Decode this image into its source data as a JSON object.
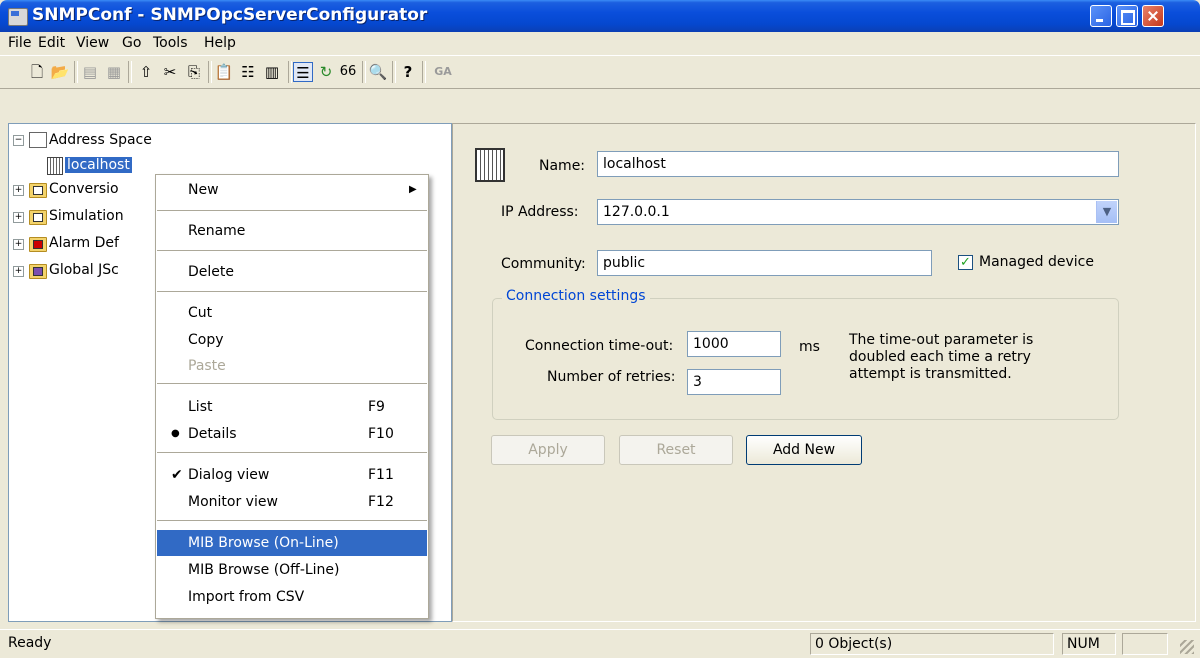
{
  "window": {
    "title": "SNMPConf - SNMPOpcServerConfigurator"
  },
  "menubar": [
    "File",
    "Edit",
    "View",
    "Go",
    "Tools",
    "Help"
  ],
  "toolbar": {
    "icons": [
      "new-icon",
      "open-icon",
      "copy-format-icon",
      "properties-icon",
      "folder-up-icon",
      "cut-icon",
      "copy-icon",
      "paste-icon",
      "list-icon",
      "details-icon",
      "dialog-view-icon",
      "refresh-icon",
      "watch-icon",
      "search-icon",
      "help-icon",
      "ga-icon"
    ],
    "ga_label": "GA"
  },
  "tree": {
    "root": "Address Space",
    "selected": "localhost",
    "items": [
      "Conversio",
      "Simulation",
      "Alarm Def",
      "Global JSc"
    ]
  },
  "context_menu": {
    "items": [
      {
        "label": "New",
        "has_submenu": true
      },
      {
        "label": "Rename"
      },
      {
        "label": "Delete"
      },
      {
        "label": "Cut"
      },
      {
        "label": "Copy"
      },
      {
        "label": "Paste",
        "disabled": true
      },
      {
        "label": "List",
        "shortcut": "F9"
      },
      {
        "label": "Details",
        "shortcut": "F10",
        "radio": true
      },
      {
        "label": "Dialog view",
        "shortcut": "F11",
        "checked": true
      },
      {
        "label": "Monitor view",
        "shortcut": "F12"
      },
      {
        "label": "MIB Browse (On-Line)",
        "highlighted": true
      },
      {
        "label": "MIB Browse (Off-Line)"
      },
      {
        "label": "Import from CSV"
      }
    ]
  },
  "form": {
    "name_label": "Name:",
    "name_value": "localhost",
    "ip_label": "IP Address:",
    "ip_value": "127.0.0.1",
    "community_label": "Community:",
    "community_value": "public",
    "managed_label": "Managed device",
    "managed_checked": true,
    "group_title": "Connection settings",
    "timeout_label": "Connection time-out:",
    "timeout_value": "1000",
    "timeout_unit": "ms",
    "retries_label": "Number of retries:",
    "retries_value": "3",
    "note_line1": "The time-out parameter is",
    "note_line2": "doubled each time a retry",
    "note_line3": "attempt is transmitted.",
    "apply_label": "Apply",
    "reset_label": "Reset",
    "addnew_label": "Add New"
  },
  "statusbar": {
    "status": "Ready",
    "objects": "0 Object(s)",
    "num": "NUM"
  },
  "colors": {
    "titlebar": "#0a4edb",
    "selection": "#316ac5",
    "group_title": "#0046d5"
  }
}
